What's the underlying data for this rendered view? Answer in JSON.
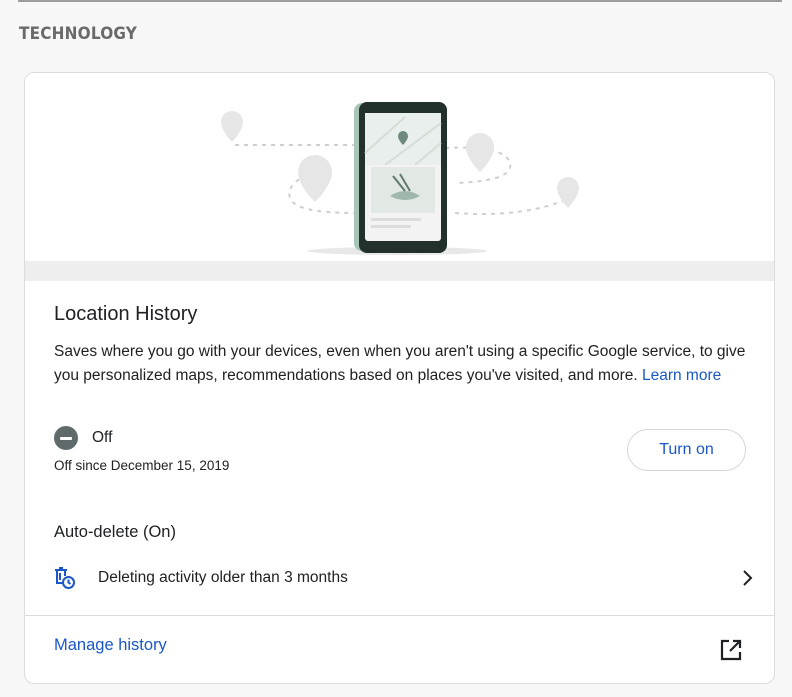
{
  "section": {
    "title": "TECHNOLOGY"
  },
  "card": {
    "title": "Location History",
    "description": "Saves where you go with your devices, even when you aren't using a specific Google service, to give you personalized maps, recommendations based on places you've visited, and more.",
    "learn_more": "Learn more",
    "status": "Off",
    "status_icon": "off-status-icon",
    "since": "Off since December 15, 2019",
    "turn_on_label": "Turn on",
    "auto_delete": {
      "title": "Auto-delete (On)",
      "text": "Deleting activity older than 3 months",
      "icon": "auto-delete-icon"
    },
    "manage_history": "Manage history",
    "external_icon": "open-in-new-icon"
  },
  "colors": {
    "link": "#1a57c9",
    "off_icon": "#5f6b6a"
  }
}
